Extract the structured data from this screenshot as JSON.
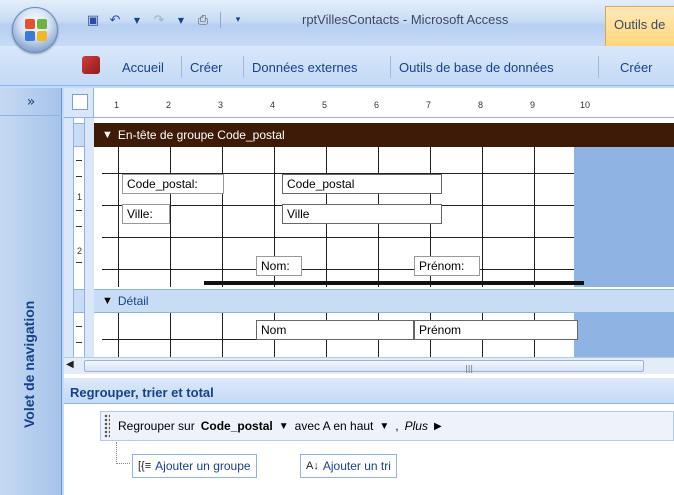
{
  "window": {
    "title": "rptVillesContacts - Microsoft Access",
    "context_tab": "Outils de",
    "qat_icons": [
      "save-icon",
      "undo-icon",
      "redo-icon",
      "print-preview-icon",
      "customize-icon"
    ]
  },
  "ribbon": {
    "tabs": [
      "Accueil",
      "Créer",
      "Données externes",
      "Outils de base de données",
      "Créer"
    ]
  },
  "nav": {
    "expand": "»",
    "label": "Volet de navigation"
  },
  "ruler": {
    "ticks": [
      "1",
      "2",
      "3",
      "4",
      "5",
      "6",
      "7",
      "8",
      "9",
      "10"
    ],
    "vticks": [
      "1",
      "2"
    ]
  },
  "sections": {
    "group_header": "En-tête de groupe Code_postal",
    "detail": "Détail"
  },
  "controls": {
    "lbl_code_postal": "Code_postal:",
    "txt_code_postal": "Code_postal",
    "lbl_ville": "Ville:",
    "txt_ville": "Ville",
    "lbl_nom": "Nom:",
    "lbl_prenom": "Prénom:",
    "txt_nom": "Nom",
    "txt_prenom": "Prénom"
  },
  "scrollbar": {
    "left_arrow": "◀",
    "grip": "|||"
  },
  "group_pane": {
    "title": "Regrouper, trier et total",
    "row": {
      "prefix": "Regrouper sur",
      "field": "Code_postal",
      "dropdown": "▼",
      "order": "avec A en haut",
      "comma": ",",
      "more": "Plus",
      "more_arrow": "▶"
    },
    "add_group": "Ajouter un groupe",
    "add_sort": "Ajouter un tri"
  }
}
